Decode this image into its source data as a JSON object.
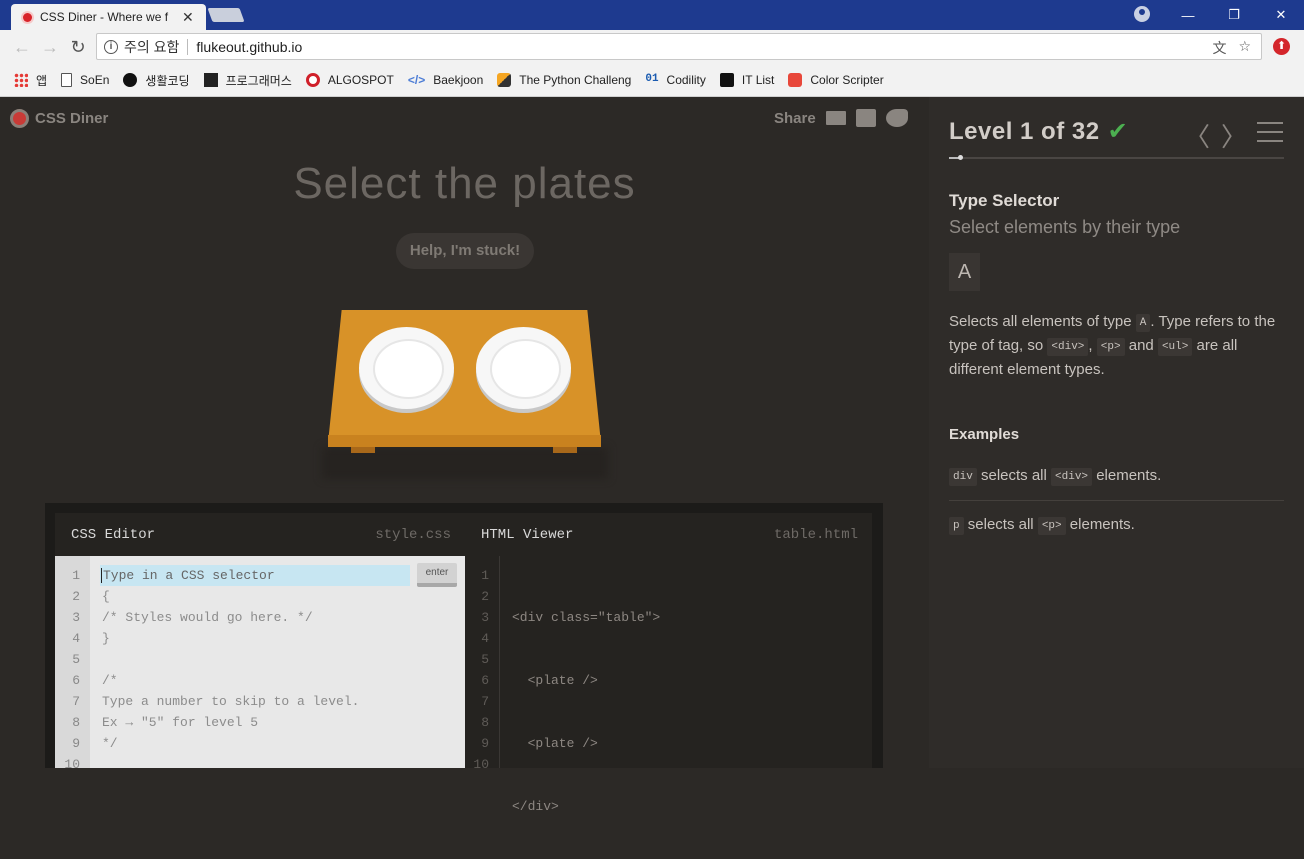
{
  "browser": {
    "tab_title": "CSS Diner - Where we f",
    "tab_close": "✕",
    "controls": {
      "minimize": "—",
      "maximize": "❐",
      "close": "✕"
    },
    "back": "←",
    "forward": "→",
    "reload": "↻",
    "security_label": "주의 요함",
    "url": "flukeout.github.io",
    "translate_icon": "文",
    "star_icon": "☆"
  },
  "bookmarks": [
    {
      "label": "앱",
      "icon": "apps"
    },
    {
      "label": "SoEn",
      "icon": "doc"
    },
    {
      "label": "생활코딩",
      "icon": "circle"
    },
    {
      "label": "프로그래머스",
      "icon": "pg"
    },
    {
      "label": "ALGOSPOT",
      "icon": "target"
    },
    {
      "label": "Baekjoon",
      "icon": "code",
      "glyph": "</>"
    },
    {
      "label": "The Python Challeng",
      "icon": "py"
    },
    {
      "label": "Codility",
      "icon": "cod",
      "glyph": "01"
    },
    {
      "label": "IT List",
      "icon": "it"
    },
    {
      "label": "Color Scripter",
      "icon": "cs"
    }
  ],
  "app": {
    "brand": "CSS Diner",
    "share_label": "Share",
    "order": "Select the plates",
    "help": "Help, I'm stuck!"
  },
  "editor": {
    "css_title": "CSS Editor",
    "css_file": "style.css",
    "input_placeholder": "Type in a CSS selector",
    "enter_label": "enter",
    "css_lines": [
      "{",
      "/* Styles would go here. */",
      "}",
      "",
      "/*",
      "Type a number to skip to a level.",
      "Ex → \"5\" for level 5",
      "*/"
    ],
    "html_title": "HTML Viewer",
    "html_file": "table.html",
    "html_lines": [
      "<div class=\"table\">",
      "  <plate />",
      "  <plate />",
      "</div>"
    ],
    "line_numbers": [
      "1",
      "2",
      "3",
      "4",
      "5",
      "6",
      "7",
      "8",
      "9",
      "10"
    ]
  },
  "sidebar": {
    "level_text": "Level 1 of 32",
    "check": "✔",
    "prev": "〈",
    "next": "〉",
    "progress": 0.03,
    "selector_name": "Type Selector",
    "selector_sub": "Select elements by their type",
    "syntax": "A",
    "desc_1": "Selects all elements of type",
    "desc_tag_a": "A",
    "desc_2": ". Type refers to the type of tag, so",
    "desc_tag_div": "<div>",
    "desc_comma": ",",
    "desc_tag_p": "<p>",
    "desc_and": "and",
    "desc_tag_ul": "<ul>",
    "desc_3": "are all different element types.",
    "examples_title": "Examples",
    "ex1_code": "div",
    "ex1_text": "selects all",
    "ex1_tag": "<div>",
    "ex1_end": "elements.",
    "ex2_code": "p",
    "ex2_text": "selects all",
    "ex2_tag": "<p>",
    "ex2_end": "elements."
  },
  "colors": {
    "accent_check": "#4caf50",
    "table": "#d89228",
    "titlebar": "#1e3a8f"
  }
}
